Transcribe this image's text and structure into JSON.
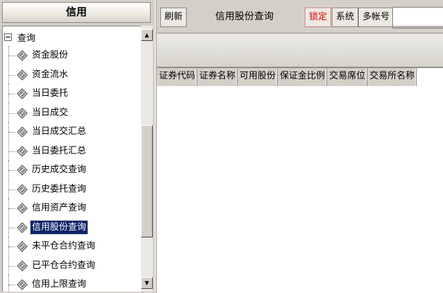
{
  "left_panel": {
    "header": "信用",
    "tree": {
      "root_label": "查询",
      "items": [
        {
          "label": "资金股份",
          "selected": false
        },
        {
          "label": "资金流水",
          "selected": false
        },
        {
          "label": "当日委托",
          "selected": false
        },
        {
          "label": "当日成交",
          "selected": false
        },
        {
          "label": "当日成交汇总",
          "selected": false
        },
        {
          "label": "当日委托汇总",
          "selected": false
        },
        {
          "label": "历史成交查询",
          "selected": false
        },
        {
          "label": "历史委托查询",
          "selected": false
        },
        {
          "label": "信用资产查询",
          "selected": false
        },
        {
          "label": "信用股份查询",
          "selected": true
        },
        {
          "label": "未平仓合约查询",
          "selected": false
        },
        {
          "label": "已平仓合约查询",
          "selected": false
        },
        {
          "label": "信用上限查询",
          "selected": false
        }
      ]
    }
  },
  "toolbar": {
    "refresh_label": "刷新",
    "title": "信用股份查询",
    "lock_label": "锁定",
    "system_label": "系统",
    "multi_account_label": "多帐号",
    "input_value": ""
  },
  "grid": {
    "columns": [
      "证券代码",
      "证券名称",
      "可用股份",
      "保证金比例",
      "交易席位",
      "交易所名称"
    ],
    "rows": []
  },
  "colors": {
    "panel_bg": "#d4d0c8",
    "selection_bg": "#0a246a",
    "lock_text": "#e00000"
  }
}
